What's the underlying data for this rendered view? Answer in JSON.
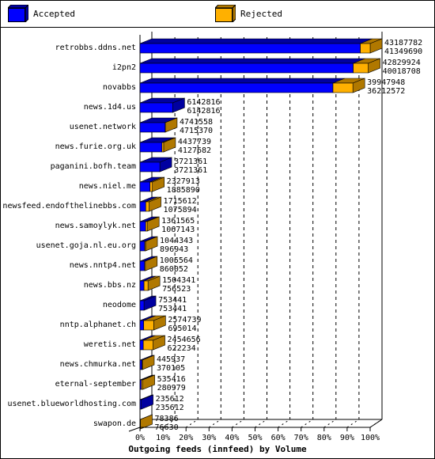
{
  "legend": [
    {
      "label": "Accepted",
      "color": "#0000ff",
      "side": "#0000a0"
    },
    {
      "label": "Rejected",
      "color": "#ffb000",
      "side": "#b07800"
    }
  ],
  "chart_data": {
    "type": "bar",
    "orientation": "horizontal",
    "stacked": true,
    "three_d": true,
    "title": "Outgoing feeds (innfeed) by Volume",
    "xlabel": "Outgoing feeds (innfeed) by Volume",
    "ylabel": "",
    "xlim": [
      0,
      100
    ],
    "xticks": [
      "0%",
      "10%",
      "20%",
      "30%",
      "40%",
      "50%",
      "60%",
      "70%",
      "80%",
      "90%",
      "100%"
    ],
    "grid": true,
    "legend_position": "top",
    "categories": [
      "retrobbs.ddns.net",
      "i2pn2",
      "novabbs",
      "news.1d4.us",
      "usenet.network",
      "news.furie.org.uk",
      "paganini.bofh.team",
      "news.niel.me",
      "newsfeed.endofthelinebbs.com",
      "news.samoylyk.net",
      "usenet.goja.nl.eu.org",
      "news.nntp4.net",
      "news.bbs.nz",
      "neodome",
      "nntp.alphanet.ch",
      "weretis.net",
      "news.chmurka.net",
      "eternal-september",
      "usenet.blueworldhosting.com",
      "swapon.de"
    ],
    "labels_total": [
      "43187782",
      "42829924",
      "39947948",
      "6142816",
      "4741558",
      "4437739",
      "3721361",
      "2327913",
      "1715612",
      "1361565",
      "1044343",
      "1005564",
      "1504341",
      "753441",
      "2574739",
      "2454656",
      "445937",
      "535416",
      "235612",
      "78386"
    ],
    "labels_accepted": [
      "41349690",
      "40018708",
      "36212572",
      "6142816",
      "4715370",
      "4127682",
      "3721361",
      "1885890",
      "1075894",
      "1067143",
      "896943",
      "860052",
      "756523",
      "753441",
      "695014",
      "622234",
      "370105",
      "280979",
      "235612",
      "76630"
    ],
    "series": [
      {
        "name": "Accepted",
        "color": "#0000ff",
        "values": [
          41349690,
          40018708,
          36212572,
          6142816,
          4715370,
          4127682,
          3721361,
          1885890,
          1075894,
          1067143,
          896943,
          860052,
          756523,
          753441,
          695014,
          622234,
          370105,
          280979,
          235612,
          76630
        ]
      },
      {
        "name": "Rejected",
        "color": "#ffb000",
        "values": [
          1838092,
          2811216,
          3735376,
          0,
          26188,
          310057,
          0,
          442023,
          639718,
          294422,
          147400,
          145512,
          747818,
          0,
          1879725,
          1832422,
          75832,
          254437,
          0,
          1756
        ]
      }
    ],
    "bar_scale_note": "front face length: accepted/max_total*? (accepted), side face colored by last segment"
  }
}
